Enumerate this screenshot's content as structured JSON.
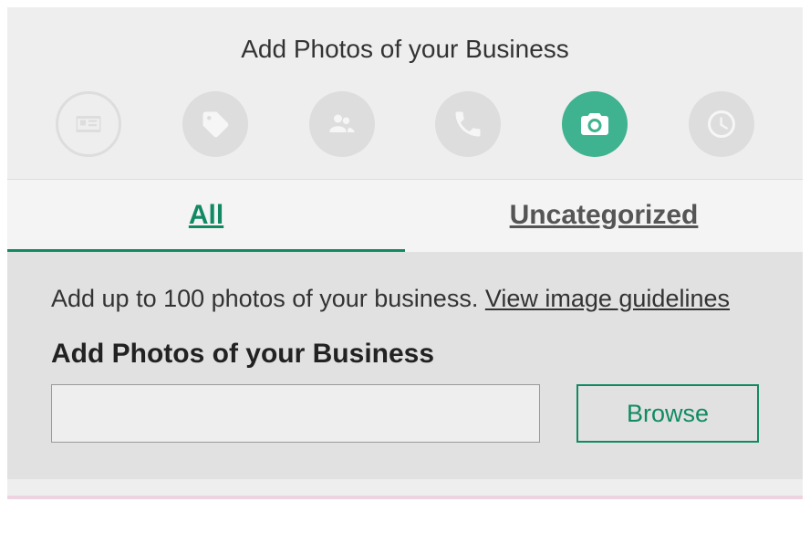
{
  "header": {
    "title": "Add Photos of your Business"
  },
  "steps": [
    {
      "name": "profile-card-icon",
      "active": false,
      "style": "outline"
    },
    {
      "name": "tag-icon",
      "active": false,
      "style": "filled"
    },
    {
      "name": "people-icon",
      "active": false,
      "style": "filled"
    },
    {
      "name": "phone-icon",
      "active": false,
      "style": "filled"
    },
    {
      "name": "camera-icon",
      "active": true,
      "style": "active"
    },
    {
      "name": "clock-icon",
      "active": false,
      "style": "filled"
    }
  ],
  "tabs": {
    "all": "All",
    "uncategorized": "Uncategorized",
    "active": "all"
  },
  "content": {
    "helper_prefix": "Add up to 100 photos of your business. ",
    "helper_link": "View image guidelines",
    "subheading": "Add Photos of your Business",
    "browse_label": "Browse",
    "file_value": ""
  },
  "colors": {
    "accent": "#118a63",
    "active_step": "#3fb28f"
  }
}
